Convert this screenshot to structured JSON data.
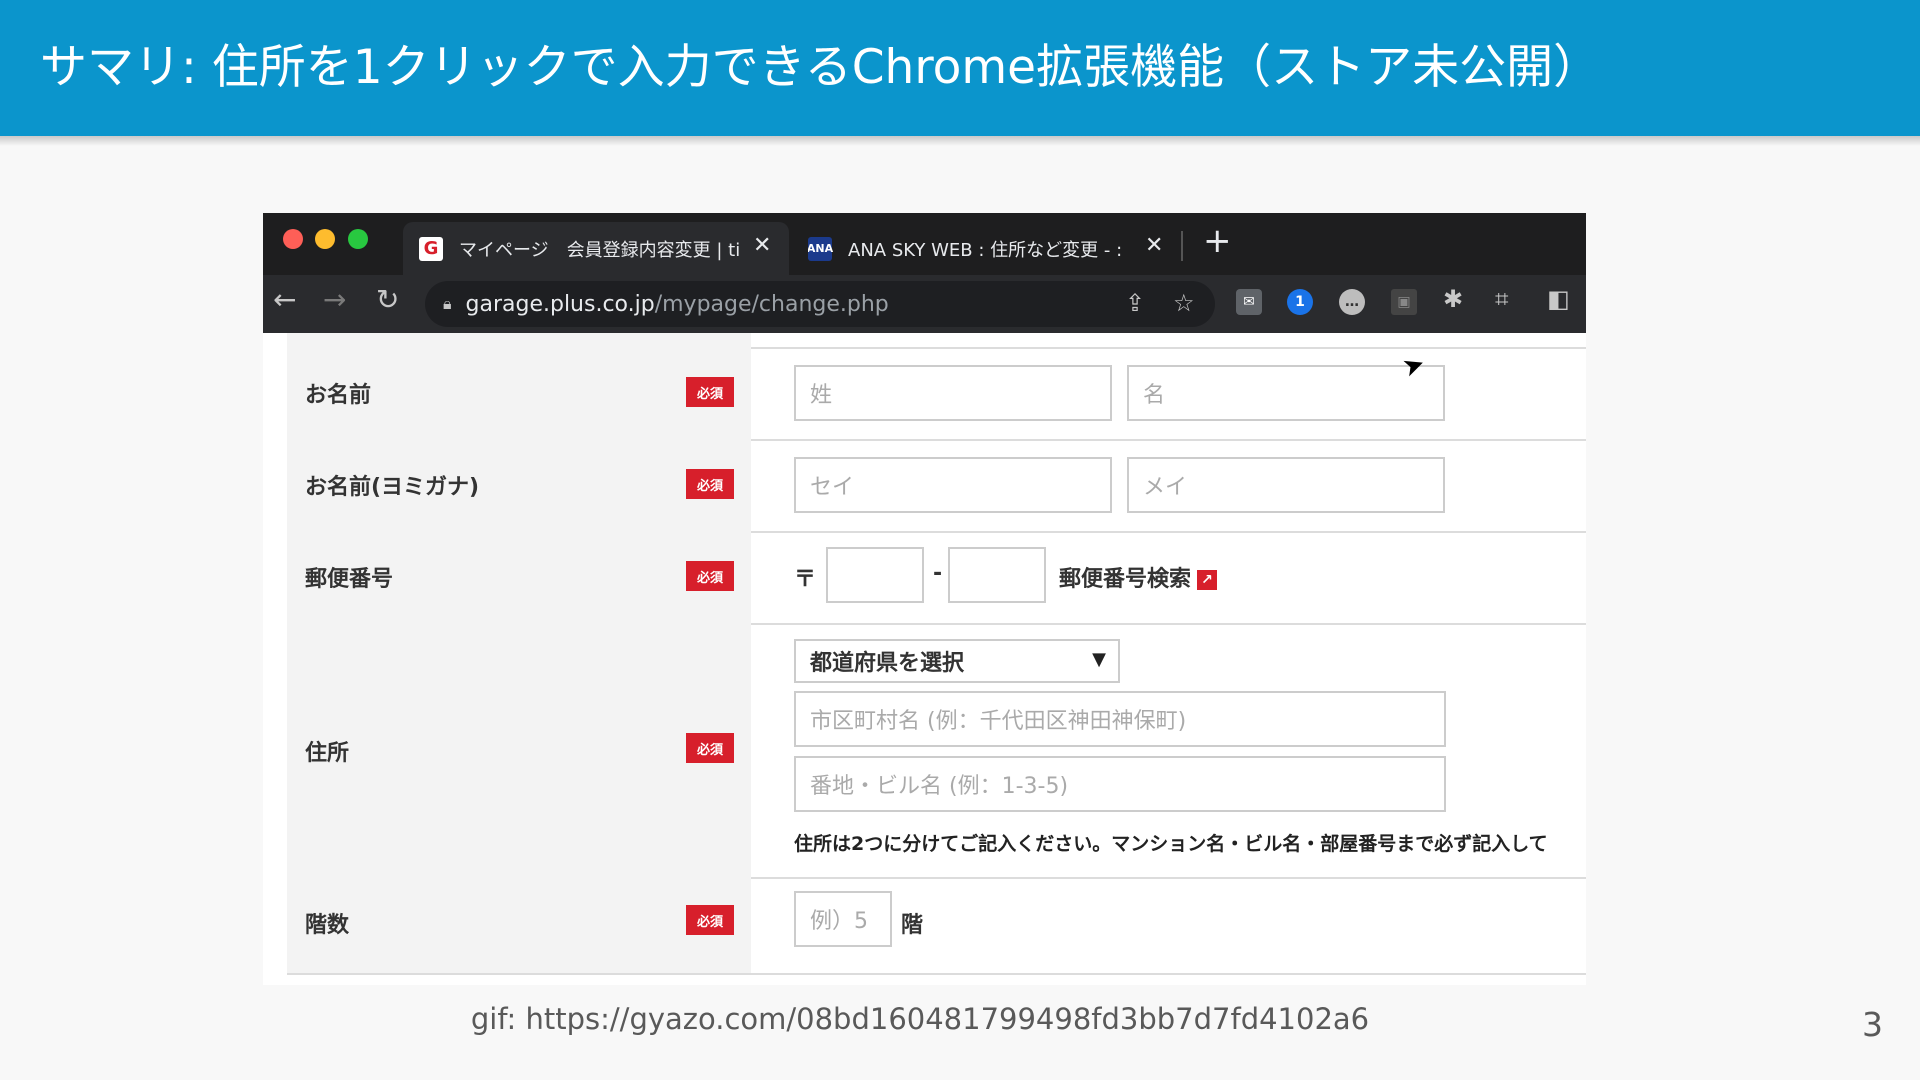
{
  "slide": {
    "title": "サマリ: 住所を1クリックで入力できるChrome拡張機能（ストア未公開）",
    "caption": "gif: https://gyazo.com/08bd160481799498fd3bb7d7fd4102a6",
    "page_number": "3",
    "header_color": "#0b95cc"
  },
  "browser": {
    "tabs": [
      {
        "favicon": "G",
        "title": "マイページ　会員登録内容変更 | ti",
        "active": true
      },
      {
        "favicon": "ANA",
        "title": "ANA SKY WEB : 住所など変更 - :",
        "active": false
      }
    ],
    "close_glyph": "✕",
    "new_tab_glyph": "+",
    "url_host": "garage.plus.co.jp",
    "url_path": "/mypage/change.php"
  },
  "form": {
    "required_badge": "必須",
    "rows": [
      {
        "label": "お名前",
        "placeholders": [
          "姓",
          "名"
        ]
      },
      {
        "label": "お名前(ヨミガナ)",
        "placeholders": [
          "セイ",
          "メイ"
        ]
      },
      {
        "label": "郵便番号",
        "postal_mark": "〒",
        "dash": "-",
        "postal_search": "郵便番号検索"
      },
      {
        "label": "住所",
        "prefecture_select": "都道府県を選択",
        "city_placeholder": "市区町村名 (例：千代田区神田神保町)",
        "street_placeholder": "番地・ビル名 (例：1-3-5)",
        "note": "住所は2つに分けてご記入ください。マンション名・ビル名・部屋番号まで必ず記入して"
      },
      {
        "label": "階数",
        "placeholder": "例）5",
        "suffix": "階"
      }
    ]
  },
  "colors": {
    "required": "#d71f2b",
    "tabstrip": "#1e1e1f",
    "toolbar": "#2a2b2e"
  }
}
